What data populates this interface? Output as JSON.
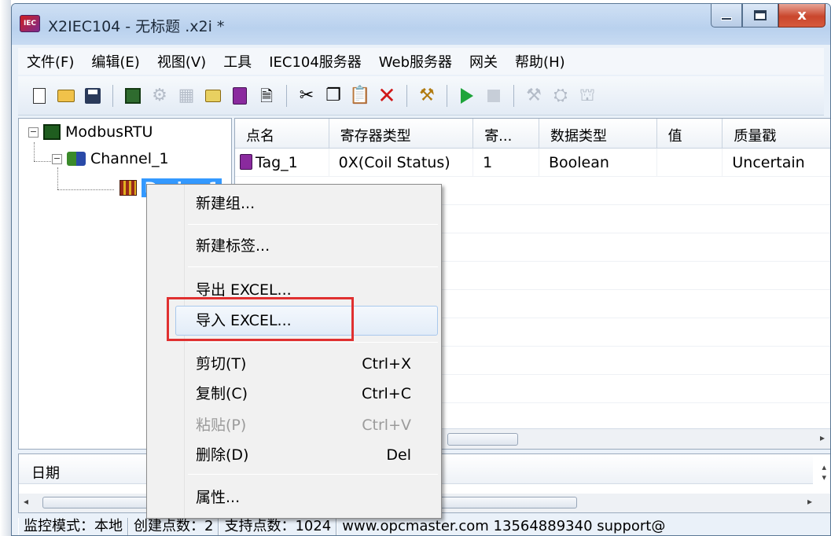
{
  "window": {
    "title": "X2IEC104 - 无标题 .x2i *",
    "app_icon_text": "IEC",
    "close_glyph": "x"
  },
  "menubar": [
    "文件(F)",
    "编辑(E)",
    "视图(V)",
    "工具",
    "IEC104服务器",
    "Web服务器",
    "网关",
    "帮助(H)"
  ],
  "toolbar": {
    "icons": [
      "new-file-icon",
      "open-folder-icon",
      "save-icon",
      "modbus-icon",
      "channel-icon",
      "device-icon",
      "new-group-icon",
      "new-tag-icon",
      "properties-icon",
      "cut-icon",
      "copy-icon",
      "paste-icon",
      "delete-icon",
      "tool-icon",
      "run-icon",
      "stop-icon",
      "settings-icon",
      "load-icon",
      "upload-icon"
    ]
  },
  "tree": {
    "root": "ModbusRTU",
    "channel": "Channel_1",
    "device": "Device_1",
    "root_expander": "−",
    "channel_expander": "−"
  },
  "grid": {
    "columns": [
      "点名",
      "寄存器类型",
      "寄...",
      "数据类型",
      "值",
      "质量戳"
    ],
    "rows": [
      [
        "Tag_1",
        "0X(Coil Status)",
        "1",
        "Boolean",
        "",
        "Uncertain"
      ]
    ]
  },
  "log": {
    "column": "日期"
  },
  "statusbar": [
    "监控模式：本地",
    "创建点数：2",
    "支持点数：1024",
    "www.opcmaster.com 13564889340 support@"
  ],
  "context_menu": {
    "items": [
      {
        "label": "新建组..."
      },
      {
        "label": "新建标签..."
      },
      {
        "label": "导出 EXCEL..."
      },
      {
        "label": "导入 EXCEL..."
      },
      {
        "label": "剪切(T)",
        "shortcut": "Ctrl+X"
      },
      {
        "label": "复制(C)",
        "shortcut": "Ctrl+C"
      },
      {
        "label": "粘贴(P)",
        "shortcut": "Ctrl+V"
      },
      {
        "label": "删除(D)",
        "shortcut": "Del"
      },
      {
        "label": "属性..."
      }
    ]
  },
  "colors": {
    "highlight_box": "#e03030",
    "selection": "#3399ff",
    "close_button": "#c9462c"
  }
}
